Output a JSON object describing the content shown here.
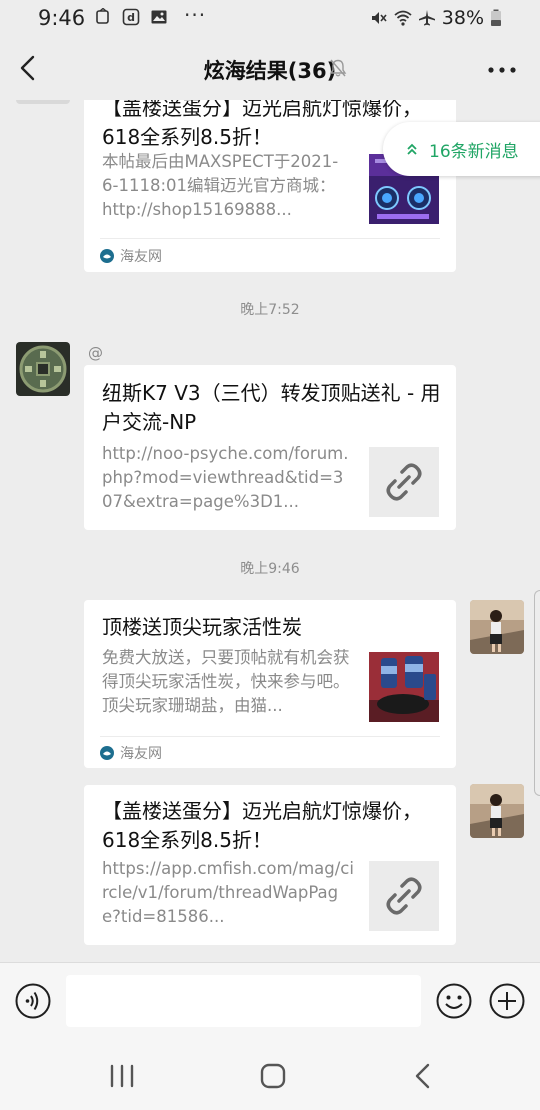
{
  "status_bar": {
    "time": "9:46",
    "dots": "···",
    "battery": "38%",
    "icons": [
      "vibrate-icon",
      "d-app-icon",
      "image-icon",
      "mute-sound-icon",
      "wifi-icon",
      "airplane-icon",
      "battery-icon"
    ]
  },
  "header": {
    "title": "炫海结果(36)",
    "icons": [
      "back-icon",
      "mute-bell-icon",
      "more-icon"
    ]
  },
  "new_messages": {
    "label": "16条新消息",
    "icon": "double-chevron-up-icon",
    "color": "#20a565"
  },
  "messages": [
    {
      "kind": "card",
      "title": "【盖楼送蛋分】迈光启航灯惊爆价，618全系列8.5折！",
      "desc": "本帖最后由MAXSPECT于2021-6-1118:01编辑迈光官方商城：http://shop15169888...",
      "source": "海友网",
      "thumb": "aquarium-product-image"
    },
    {
      "kind": "time",
      "text": "晚上7:52"
    },
    {
      "kind": "card",
      "sender_name": "@",
      "title": "纽斯K7 V3（三代）转发顶贴送礼 - 用户交流-NP",
      "desc": "http://noo-psyche.com/forum.php?mod=viewthread&tid=307&extra=page%3D1...",
      "thumb": "link-icon"
    },
    {
      "kind": "time",
      "text": "晚上9:46"
    },
    {
      "kind": "card",
      "title": "顶楼送顶尖玩家活性炭",
      "desc": "免费大放送，只要顶帖就有机会获得顶尖玩家活性炭，快来参与吧。顶尖玩家珊瑚盐，由猫...",
      "source": "海友网",
      "thumb": "activated-carbon-product-image"
    },
    {
      "kind": "card",
      "title": "【盖楼送蛋分】迈光启航灯惊爆价，618全系列8.5折！",
      "desc": "https://app.cmfish.com/mag/circle/v1/forum/threadWapPage?tid=81586...",
      "thumb": "link-icon"
    }
  ],
  "input_bar": {
    "placeholder": "",
    "icons": [
      "voice-icon",
      "emoji-icon",
      "plus-icon"
    ]
  },
  "nav_bar": {
    "icons": [
      "recent-apps-icon",
      "home-icon",
      "back-nav-icon"
    ]
  },
  "colors": {
    "background": "#ededed",
    "accent": "#20a565",
    "card": "#ffffff"
  }
}
